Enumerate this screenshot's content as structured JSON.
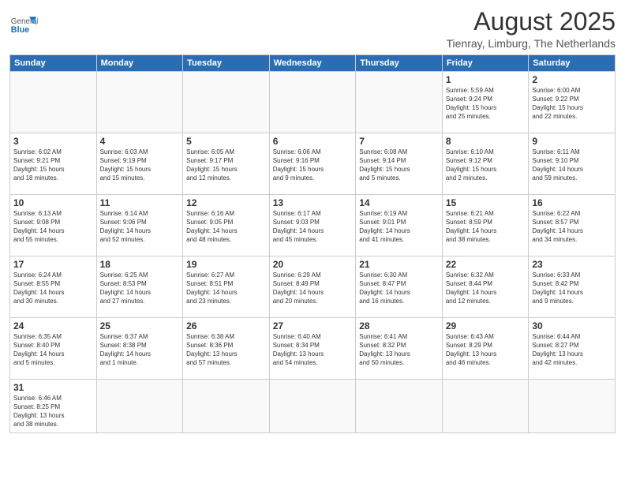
{
  "header": {
    "logo_general": "General",
    "logo_blue": "Blue",
    "month_year": "August 2025",
    "location": "Tienray, Limburg, The Netherlands"
  },
  "weekdays": [
    "Sunday",
    "Monday",
    "Tuesday",
    "Wednesday",
    "Thursday",
    "Friday",
    "Saturday"
  ],
  "weeks": [
    [
      {
        "day": "",
        "info": ""
      },
      {
        "day": "",
        "info": ""
      },
      {
        "day": "",
        "info": ""
      },
      {
        "day": "",
        "info": ""
      },
      {
        "day": "",
        "info": ""
      },
      {
        "day": "1",
        "info": "Sunrise: 5:59 AM\nSunset: 9:24 PM\nDaylight: 15 hours\nand 25 minutes."
      },
      {
        "day": "2",
        "info": "Sunrise: 6:00 AM\nSunset: 9:22 PM\nDaylight: 15 hours\nand 22 minutes."
      }
    ],
    [
      {
        "day": "3",
        "info": "Sunrise: 6:02 AM\nSunset: 9:21 PM\nDaylight: 15 hours\nand 18 minutes."
      },
      {
        "day": "4",
        "info": "Sunrise: 6:03 AM\nSunset: 9:19 PM\nDaylight: 15 hours\nand 15 minutes."
      },
      {
        "day": "5",
        "info": "Sunrise: 6:05 AM\nSunset: 9:17 PM\nDaylight: 15 hours\nand 12 minutes."
      },
      {
        "day": "6",
        "info": "Sunrise: 6:06 AM\nSunset: 9:16 PM\nDaylight: 15 hours\nand 9 minutes."
      },
      {
        "day": "7",
        "info": "Sunrise: 6:08 AM\nSunset: 9:14 PM\nDaylight: 15 hours\nand 5 minutes."
      },
      {
        "day": "8",
        "info": "Sunrise: 6:10 AM\nSunset: 9:12 PM\nDaylight: 15 hours\nand 2 minutes."
      },
      {
        "day": "9",
        "info": "Sunrise: 6:11 AM\nSunset: 9:10 PM\nDaylight: 14 hours\nand 59 minutes."
      }
    ],
    [
      {
        "day": "10",
        "info": "Sunrise: 6:13 AM\nSunset: 9:08 PM\nDaylight: 14 hours\nand 55 minutes."
      },
      {
        "day": "11",
        "info": "Sunrise: 6:14 AM\nSunset: 9:06 PM\nDaylight: 14 hours\nand 52 minutes."
      },
      {
        "day": "12",
        "info": "Sunrise: 6:16 AM\nSunset: 9:05 PM\nDaylight: 14 hours\nand 48 minutes."
      },
      {
        "day": "13",
        "info": "Sunrise: 6:17 AM\nSunset: 9:03 PM\nDaylight: 14 hours\nand 45 minutes."
      },
      {
        "day": "14",
        "info": "Sunrise: 6:19 AM\nSunset: 9:01 PM\nDaylight: 14 hours\nand 41 minutes."
      },
      {
        "day": "15",
        "info": "Sunrise: 6:21 AM\nSunset: 8:59 PM\nDaylight: 14 hours\nand 38 minutes."
      },
      {
        "day": "16",
        "info": "Sunrise: 6:22 AM\nSunset: 8:57 PM\nDaylight: 14 hours\nand 34 minutes."
      }
    ],
    [
      {
        "day": "17",
        "info": "Sunrise: 6:24 AM\nSunset: 8:55 PM\nDaylight: 14 hours\nand 30 minutes."
      },
      {
        "day": "18",
        "info": "Sunrise: 6:25 AM\nSunset: 8:53 PM\nDaylight: 14 hours\nand 27 minutes."
      },
      {
        "day": "19",
        "info": "Sunrise: 6:27 AM\nSunset: 8:51 PM\nDaylight: 14 hours\nand 23 minutes."
      },
      {
        "day": "20",
        "info": "Sunrise: 6:29 AM\nSunset: 8:49 PM\nDaylight: 14 hours\nand 20 minutes."
      },
      {
        "day": "21",
        "info": "Sunrise: 6:30 AM\nSunset: 8:47 PM\nDaylight: 14 hours\nand 16 minutes."
      },
      {
        "day": "22",
        "info": "Sunrise: 6:32 AM\nSunset: 8:44 PM\nDaylight: 14 hours\nand 12 minutes."
      },
      {
        "day": "23",
        "info": "Sunrise: 6:33 AM\nSunset: 8:42 PM\nDaylight: 14 hours\nand 9 minutes."
      }
    ],
    [
      {
        "day": "24",
        "info": "Sunrise: 6:35 AM\nSunset: 8:40 PM\nDaylight: 14 hours\nand 5 minutes."
      },
      {
        "day": "25",
        "info": "Sunrise: 6:37 AM\nSunset: 8:38 PM\nDaylight: 14 hours\nand 1 minute."
      },
      {
        "day": "26",
        "info": "Sunrise: 6:38 AM\nSunset: 8:36 PM\nDaylight: 13 hours\nand 57 minutes."
      },
      {
        "day": "27",
        "info": "Sunrise: 6:40 AM\nSunset: 8:34 PM\nDaylight: 13 hours\nand 54 minutes."
      },
      {
        "day": "28",
        "info": "Sunrise: 6:41 AM\nSunset: 8:32 PM\nDaylight: 13 hours\nand 50 minutes."
      },
      {
        "day": "29",
        "info": "Sunrise: 6:43 AM\nSunset: 8:29 PM\nDaylight: 13 hours\nand 46 minutes."
      },
      {
        "day": "30",
        "info": "Sunrise: 6:44 AM\nSunset: 8:27 PM\nDaylight: 13 hours\nand 42 minutes."
      }
    ],
    [
      {
        "day": "31",
        "info": "Sunrise: 6:46 AM\nSunset: 8:25 PM\nDaylight: 13 hours\nand 38 minutes."
      },
      {
        "day": "",
        "info": ""
      },
      {
        "day": "",
        "info": ""
      },
      {
        "day": "",
        "info": ""
      },
      {
        "day": "",
        "info": ""
      },
      {
        "day": "",
        "info": ""
      },
      {
        "day": "",
        "info": ""
      }
    ]
  ]
}
